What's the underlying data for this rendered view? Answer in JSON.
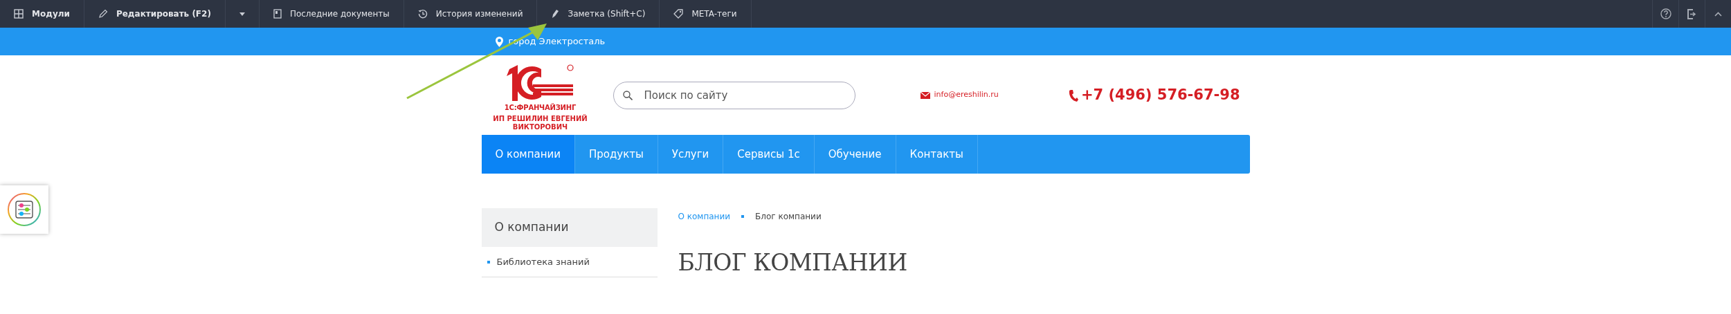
{
  "toolbar": {
    "items": [
      {
        "kind": "button",
        "label": "Модули",
        "bold": true
      },
      {
        "kind": "button",
        "label": "Редактировать (F2)",
        "bold": true
      },
      {
        "kind": "dropdown"
      },
      {
        "kind": "button",
        "label": "Последние документы",
        "bold": false
      },
      {
        "kind": "button",
        "label": "История изменений",
        "bold": false
      },
      {
        "kind": "button",
        "label": "Заметка (Shift+C)",
        "bold": false
      },
      {
        "kind": "button",
        "label": "META-теги",
        "bold": false
      }
    ]
  },
  "city": "город Электросталь",
  "logo": {
    "brand": "1С:ФРАНЧАЙЗИНГ",
    "owner": "ИП РЕШИЛИН ЕВГЕНИЙ ВИКТОРОВИЧ"
  },
  "search": {
    "placeholder": "Поиск по сайту"
  },
  "email": "info@ereshilin.ru",
  "phone": "+7 (496) 576-67-98",
  "menu": [
    {
      "label": "О компании",
      "selected": true
    },
    {
      "label": "Продукты",
      "selected": false
    },
    {
      "label": "Услуги",
      "selected": false
    },
    {
      "label": "Сервисы 1с",
      "selected": false
    },
    {
      "label": "Обучение",
      "selected": false
    },
    {
      "label": "Контакты",
      "selected": false
    }
  ],
  "sidebar": {
    "title": "О компании",
    "items": [
      "Библиотека знаний"
    ]
  },
  "breadcrumb": [
    "О компании",
    "Блог компании"
  ],
  "page_title": "БЛОГ КОМПАНИИ"
}
